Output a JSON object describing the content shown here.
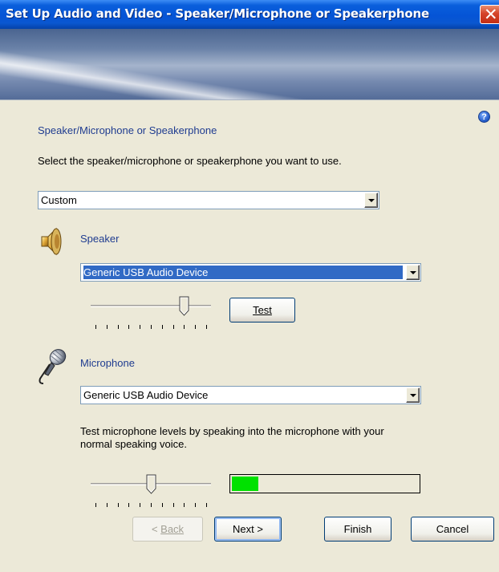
{
  "window": {
    "title": "Set Up Audio and Video - Speaker/Microphone or Speakerphone",
    "close_glyph": "✕"
  },
  "section_heading": "Speaker/Microphone or Speakerphone",
  "instruction": "Select the speaker/microphone or speakerphone you want to use.",
  "device_profile": {
    "selected": "Custom"
  },
  "speaker": {
    "icon": "speaker-icon",
    "label": "Speaker",
    "device": "Generic USB Audio Device",
    "test_label": "Test",
    "volume_level": 0.8
  },
  "microphone": {
    "icon": "microphone-icon",
    "label": "Microphone",
    "device": "Generic USB Audio Device",
    "hint": "Test microphone levels by speaking into the microphone with your normal speaking voice.",
    "hint_line1": "Test microphone levels by speaking into the microphone with your",
    "hint_line2": "normal speaking voice.",
    "volume_level": 0.5,
    "input_level": 0.14,
    "level_color": "#00e100"
  },
  "footer": {
    "back_label": "Back",
    "next_label": "Next >",
    "finish_label": "Finish",
    "cancel_label": "Cancel"
  },
  "help_icon": "help-icon",
  "colors": {
    "accent": "#316ac5",
    "heading": "#1f3c90",
    "titlebar": "#0554d6"
  }
}
